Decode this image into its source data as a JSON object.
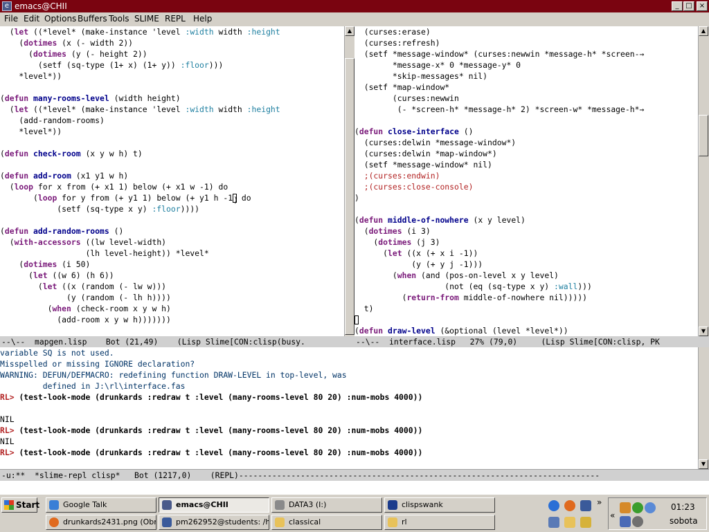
{
  "window": {
    "title": "emacs@CHII",
    "minimize": "_",
    "maximize": "□",
    "close": "×"
  },
  "menu": [
    "File",
    "Edit",
    "Options",
    "Buffers",
    "Tools",
    "SLIME",
    "REPL",
    "Help"
  ],
  "left_pane": {
    "lines": [
      [
        {
          "t": "  ("
        },
        {
          "t": "let",
          "c": "kw"
        },
        {
          "t": " ((*level* (make-instance 'level "
        },
        {
          "t": ":width",
          "c": "kwd"
        },
        {
          "t": " width "
        },
        {
          "t": ":height",
          "c": "kwd"
        }
      ],
      [
        {
          "t": "    ("
        },
        {
          "t": "dotimes",
          "c": "kw"
        },
        {
          "t": " (x (- width 2))"
        }
      ],
      [
        {
          "t": "      ("
        },
        {
          "t": "dotimes",
          "c": "kw"
        },
        {
          "t": " (y (- height 2))"
        }
      ],
      [
        {
          "t": "        (setf (sq-type (1+ x) (1+ y)) "
        },
        {
          "t": ":floor",
          "c": "kwd"
        },
        {
          "t": ")))"
        }
      ],
      [
        {
          "t": "    *level*))"
        }
      ],
      [],
      [
        {
          "t": "("
        },
        {
          "t": "defun",
          "c": "kw"
        },
        {
          "t": " "
        },
        {
          "t": "many-rooms-level",
          "c": "fn"
        },
        {
          "t": " (width height)"
        }
      ],
      [
        {
          "t": "  ("
        },
        {
          "t": "let",
          "c": "kw"
        },
        {
          "t": " ((*level* (make-instance 'level "
        },
        {
          "t": ":width",
          "c": "kwd"
        },
        {
          "t": " width "
        },
        {
          "t": ":height",
          "c": "kwd"
        }
      ],
      [
        {
          "t": "    (add-random-rooms)"
        }
      ],
      [
        {
          "t": "    *level*))"
        }
      ],
      [],
      [
        {
          "t": "("
        },
        {
          "t": "defun",
          "c": "kw"
        },
        {
          "t": " "
        },
        {
          "t": "check-room",
          "c": "fn"
        },
        {
          "t": " (x y w h) t)"
        }
      ],
      [],
      [
        {
          "t": "("
        },
        {
          "t": "defun",
          "c": "kw"
        },
        {
          "t": " "
        },
        {
          "t": "add-room",
          "c": "fn"
        },
        {
          "t": " (x1 y1 w h)"
        }
      ],
      [
        {
          "t": "  ("
        },
        {
          "t": "loop",
          "c": "kw"
        },
        {
          "t": " for x from (+ x1 1) below (+ x1 w -1) do"
        }
      ],
      [
        {
          "t": "       ("
        },
        {
          "t": "loop",
          "c": "kw"
        },
        {
          "t": " for y from (+ y1 1) below (+ y1 h -1"
        },
        {
          "t": ")",
          "c": "cursor"
        },
        {
          "t": " do"
        }
      ],
      [
        {
          "t": "            (setf (sq-type x y) "
        },
        {
          "t": ":floor",
          "c": "kwd"
        },
        {
          "t": "))))"
        }
      ],
      [],
      [
        {
          "t": "("
        },
        {
          "t": "defun",
          "c": "kw"
        },
        {
          "t": " "
        },
        {
          "t": "add-random-rooms",
          "c": "fn"
        },
        {
          "t": " ()"
        }
      ],
      [
        {
          "t": "  ("
        },
        {
          "t": "with-accessors",
          "c": "kw"
        },
        {
          "t": " ((lw level-width)"
        }
      ],
      [
        {
          "t": "                  (lh level-height)) *level*"
        }
      ],
      [
        {
          "t": "    ("
        },
        {
          "t": "dotimes",
          "c": "kw"
        },
        {
          "t": " (i 50)"
        }
      ],
      [
        {
          "t": "      ("
        },
        {
          "t": "let",
          "c": "kw"
        },
        {
          "t": " ((w 6) (h 6))"
        }
      ],
      [
        {
          "t": "        ("
        },
        {
          "t": "let",
          "c": "kw"
        },
        {
          "t": " ((x (random (- lw w)))"
        }
      ],
      [
        {
          "t": "              (y (random (- lh h))))"
        }
      ],
      [
        {
          "t": "          ("
        },
        {
          "t": "when",
          "c": "kw"
        },
        {
          "t": " (check-room x y w h)"
        }
      ],
      [
        {
          "t": "            (add-room x y w h)))))))"
        }
      ]
    ],
    "modeline": "--\\--  mapgen.lisp    Bot (21,49)    (Lisp Slime[CON:clisp(busy."
  },
  "right_pane": {
    "lines": [
      [
        {
          "t": "  (curses:erase)"
        }
      ],
      [
        {
          "t": "  (curses:refresh)"
        }
      ],
      [
        {
          "t": "  (setf *message-window* (curses:newwin *message-h* *screen-"
        },
        {
          "t": "→",
          "c": "arrow"
        }
      ],
      [
        {
          "t": "        *message-x* 0 *message-y* 0"
        }
      ],
      [
        {
          "t": "        *skip-messages* nil)"
        }
      ],
      [
        {
          "t": "  (setf *map-window*"
        }
      ],
      [
        {
          "t": "        (curses:newwin"
        }
      ],
      [
        {
          "t": "         (- *screen-h* *message-h* 2) *screen-w* *message-h*"
        },
        {
          "t": "→",
          "c": "arrow"
        }
      ],
      [],
      [
        {
          "t": "("
        },
        {
          "t": "defun",
          "c": "kw"
        },
        {
          "t": " "
        },
        {
          "t": "close-interface",
          "c": "fn"
        },
        {
          "t": " ()"
        }
      ],
      [
        {
          "t": "  (curses:delwin *message-window*)"
        }
      ],
      [
        {
          "t": "  (curses:delwin *map-window*)"
        }
      ],
      [
        {
          "t": "  (setf *message-window* nil)"
        }
      ],
      [
        {
          "t": "  ;(curses:endwin)",
          "c": "cm"
        }
      ],
      [
        {
          "t": "  ;(curses:close-console)",
          "c": "cm"
        }
      ],
      [
        {
          "t": ")"
        }
      ],
      [],
      [
        {
          "t": "("
        },
        {
          "t": "defun",
          "c": "kw"
        },
        {
          "t": " "
        },
        {
          "t": "middle-of-nowhere",
          "c": "fn"
        },
        {
          "t": " (x y level)"
        }
      ],
      [
        {
          "t": "  ("
        },
        {
          "t": "dotimes",
          "c": "kw"
        },
        {
          "t": " (i 3)"
        }
      ],
      [
        {
          "t": "    ("
        },
        {
          "t": "dotimes",
          "c": "kw"
        },
        {
          "t": " (j 3)"
        }
      ],
      [
        {
          "t": "      ("
        },
        {
          "t": "let",
          "c": "kw"
        },
        {
          "t": " ((x (+ x i -1))"
        }
      ],
      [
        {
          "t": "            (y (+ y j -1)))"
        }
      ],
      [
        {
          "t": "        ("
        },
        {
          "t": "when",
          "c": "kw"
        },
        {
          "t": " (and (pos-on-level x y level)"
        }
      ],
      [
        {
          "t": "                   (not (eq (sq-type x y) "
        },
        {
          "t": ":wall",
          "c": "kwd"
        },
        {
          "t": ")))"
        }
      ],
      [
        {
          "t": "          ("
        },
        {
          "t": "return-from",
          "c": "kw"
        },
        {
          "t": " middle-of-nowhere nil)))))"
        }
      ],
      [
        {
          "t": "  t)"
        }
      ],
      [
        {
          "t": " ",
          "c": "cursor"
        }
      ],
      [
        {
          "t": "("
        },
        {
          "t": "defun",
          "c": "kw"
        },
        {
          "t": " "
        },
        {
          "t": "draw-level",
          "c": "fn"
        },
        {
          "t": " (&optional (level *level*))"
        }
      ]
    ],
    "modeline": "--\\--  interface.lisp   27% (79,0)     (Lisp Slime[CON:clisp, PK"
  },
  "repl": {
    "lines": [
      [
        {
          "t": "variable SQ is not used.",
          "c": "warn"
        }
      ],
      [
        {
          "t": "Misspelled or missing IGNORE declaration?",
          "c": "warn"
        }
      ],
      [
        {
          "t": "WARNING: DEFUN/DEFMACRO: redefining function DRAW-LEVEL in top-level, was",
          "c": "warn"
        }
      ],
      [
        {
          "t": "         defined in J:\\rl\\interface.fas",
          "c": "warn"
        }
      ],
      [
        {
          "t": "RL> ",
          "c": "pr"
        },
        {
          "t": "(test-look-mode (drunkards :redraw t :level (many-rooms-level 80 20) :num-mobs 4000))",
          "c": "bold"
        }
      ],
      [],
      [
        {
          "t": "NIL"
        }
      ],
      [
        {
          "t": "RL> ",
          "c": "pr"
        },
        {
          "t": "(test-look-mode (drunkards :redraw t :level (many-rooms-level 80 20) :num-mobs 4000))",
          "c": "bold"
        }
      ],
      [
        {
          "t": "NIL"
        }
      ],
      [
        {
          "t": "RL> ",
          "c": "pr"
        },
        {
          "t": "(test-look-mode (drunkards :redraw t :level (many-rooms-level 80 20) :num-mobs 4000))",
          "c": "bold"
        }
      ]
    ],
    "modeline": "-u:**  *slime-repl clisp*   Bot (1217,0)    (REPL)----------------------------------------------------------------------------"
  },
  "taskbar": {
    "start": "Start",
    "buttons": [
      {
        "label": "Google Talk",
        "icon": "google-talk-icon",
        "color": "#3a7fd6"
      },
      {
        "label": "emacs@CHII",
        "icon": "emacs-icon",
        "color": "#4a5a8a",
        "active": true
      },
      {
        "label": "DATA3 (I:)",
        "icon": "drive-icon",
        "color": "#8a8a8a"
      },
      {
        "label": "clispswank",
        "icon": "console-icon",
        "color": "#1c3c8c"
      },
      {
        "label": "drunkards2431.png (Obra...",
        "icon": "firefox-icon",
        "color": "#e06a1e"
      },
      {
        "label": "pm262952@students: /h...",
        "icon": "putty-icon",
        "color": "#3a5a9a"
      },
      {
        "label": "classical",
        "icon": "folder-icon",
        "color": "#e8c25a"
      },
      {
        "label": "rl",
        "icon": "folder-icon",
        "color": "#e8c25a"
      }
    ],
    "quicklaunch": [
      {
        "icon": "ie-icon",
        "color": "#2a6fd6"
      },
      {
        "icon": "firefox-icon",
        "color": "#e06a1e"
      },
      {
        "icon": "window-icon",
        "color": "#3a5a9a"
      },
      {
        "icon": "show-desktop-icon",
        "color": "#5a7ab6"
      },
      {
        "icon": "folder-icon",
        "color": "#e8c25a"
      },
      {
        "icon": "help-icon",
        "color": "#d6b23a"
      }
    ],
    "overflow": "»",
    "tray_expand": "«",
    "tray_icons": [
      {
        "icon": "network-icon",
        "color": "#d68a2a"
      },
      {
        "icon": "utorrent-icon",
        "color": "#3a9d2d"
      },
      {
        "icon": "talk-icon",
        "color": "#5a8ad6"
      },
      {
        "icon": "volume-icon",
        "color": "#4a6ab6"
      },
      {
        "icon": "settings-icon",
        "color": "#707070"
      }
    ],
    "clock": "01:23",
    "day": "sobota"
  }
}
